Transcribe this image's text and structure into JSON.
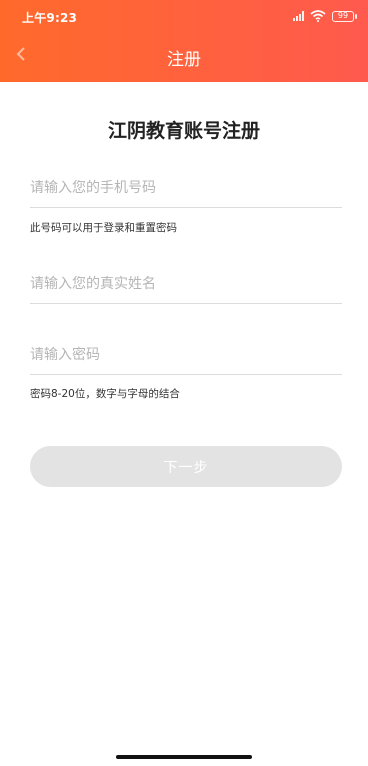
{
  "status_bar": {
    "time": "上午9:23",
    "battery": "99"
  },
  "nav": {
    "title": "注册",
    "back_icon": "chevron-left-icon"
  },
  "form": {
    "heading": "江阴教育账号注册",
    "phone_placeholder": "请输入您的手机号码",
    "phone_value": "",
    "phone_hint": "此号码可以用于登录和重置密码",
    "name_placeholder": "请输入您的真实姓名",
    "name_value": "",
    "password_placeholder": "请输入密码",
    "password_value": "",
    "password_hint": "密码8-20位，数字与字母的结合",
    "next_label": "下一步"
  },
  "colors": {
    "header_start": "#ff6a2b",
    "header_end": "#ff5a4e",
    "button_disabled": "#e3e3e3"
  }
}
